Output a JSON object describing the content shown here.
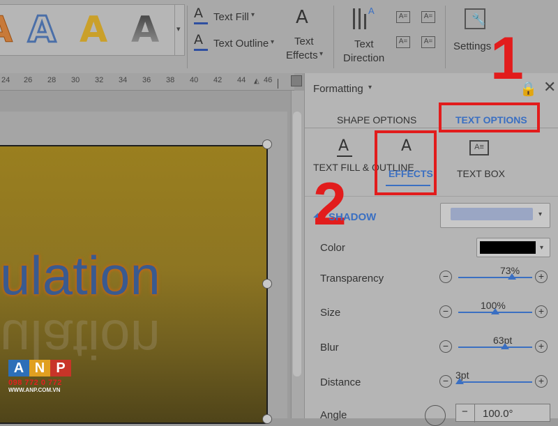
{
  "ribbon": {
    "wordart_gallery": {
      "letter": "A"
    },
    "text_fill_label": "Text Fill",
    "text_outline_label": "Text Outline",
    "text_effects_label": [
      "Text",
      "Effects"
    ],
    "text_direction_label": [
      "Text",
      "Direction"
    ],
    "settings_label": "Settings"
  },
  "ruler": {
    "ticks": [
      "24",
      "26",
      "28",
      "30",
      "32",
      "34",
      "36",
      "38",
      "40",
      "42",
      "44",
      "46"
    ]
  },
  "document": {
    "visible_text": "ulation",
    "reflection_text": "ulation"
  },
  "panel": {
    "title": "Formatting",
    "tabs": {
      "shape_options": "SHAPE OPTIONS",
      "text_options": "TEXT OPTIONS"
    },
    "subtabs": {
      "fill_outline": "TEXT FILL & OUTLINE",
      "effects": "EFFECTS",
      "text_box": "TEXT BOX"
    },
    "section": {
      "title": "SHADOW"
    },
    "rows": {
      "color": "Color",
      "transparency": {
        "label": "Transparency",
        "value": "73%",
        "fraction": 0.73
      },
      "size": {
        "label": "Size",
        "value": "100%",
        "fraction": 0.5
      },
      "blur": {
        "label": "Blur",
        "value": "63pt",
        "fraction": 0.63
      },
      "distance": {
        "label": "Distance",
        "value": "3pt",
        "fraction": 0.02
      },
      "angle": {
        "label": "Angle",
        "value": "100.0°"
      }
    }
  },
  "annotations": {
    "step1": "1",
    "step2": "2"
  },
  "watermark": {
    "letters": [
      "A",
      "N",
      "P"
    ],
    "phone": "098 772 0 772",
    "site": "WWW.ANP.COM.VN"
  },
  "colors": {
    "accent": "#3a6fc2",
    "highlight": "#e21c1c",
    "shadow_color": "#000000"
  }
}
